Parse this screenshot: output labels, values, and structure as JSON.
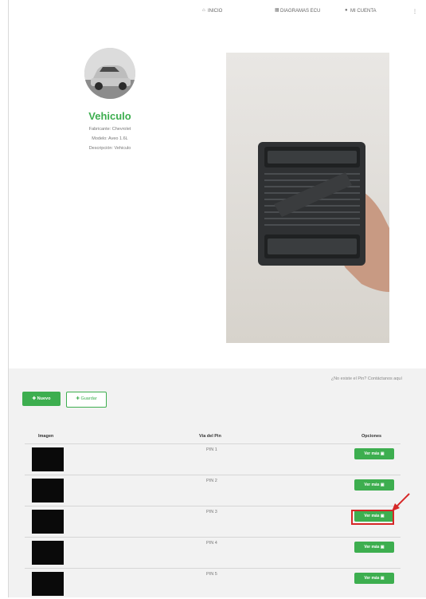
{
  "nav": {
    "items": [
      {
        "icon": "home-icon",
        "label": "INICIO"
      },
      {
        "icon": "grid-icon",
        "label": "DIAGRAMAS ECU"
      },
      {
        "icon": "user-icon",
        "label": "MI CUENTA"
      }
    ]
  },
  "profile": {
    "title": "Vehiculo",
    "lines": [
      "Fabricante: Chevrolet",
      "Modelo: Aveo 1.6L",
      "Descripción: Vehiculo"
    ]
  },
  "actions": {
    "note": "¿No existe el Pin? Contáctanos aquí",
    "new_label": "Nuevo",
    "outline_label": "Guardar"
  },
  "table": {
    "headers": [
      "Imagen",
      "Vía del Pin",
      "Opciones"
    ],
    "rows": [
      {
        "pin": "PIN 1",
        "action": "Ver más"
      },
      {
        "pin": "PIN 2",
        "action": "Ver más"
      },
      {
        "pin": "PIN 3",
        "action": "Ver más"
      },
      {
        "pin": "PIN 4",
        "action": "Ver más"
      },
      {
        "pin": "PIN 5",
        "action": "Ver más"
      }
    ]
  },
  "colors": {
    "accent": "#3dae4f",
    "highlight": "#d62828"
  }
}
